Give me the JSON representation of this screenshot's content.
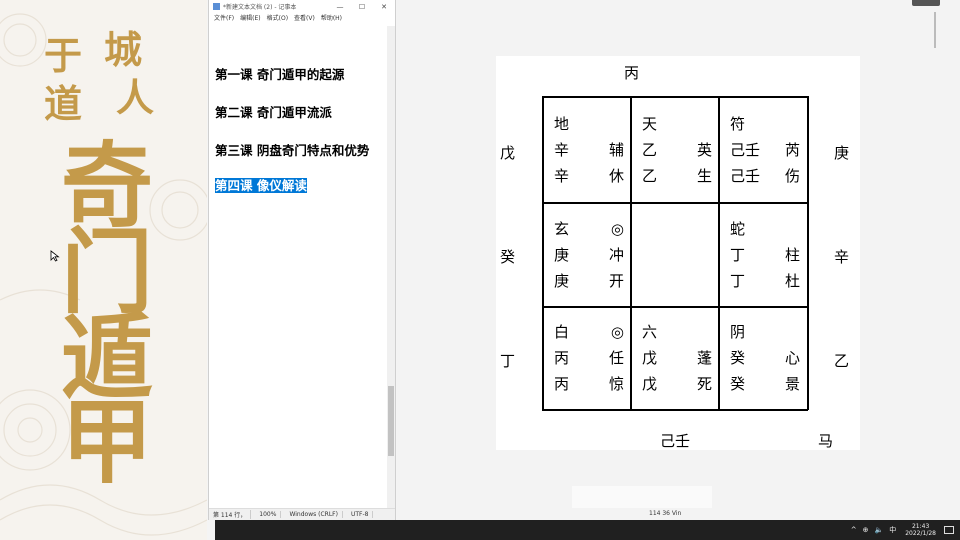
{
  "banner": {
    "author_chars": [
      "于",
      "城",
      "道",
      "人"
    ],
    "title_chars": [
      "奇",
      "门",
      "遁",
      "甲"
    ]
  },
  "notepad": {
    "window_title": "*新建文本文档 (2) - 记事本",
    "controls": [
      "—",
      "☐",
      "✕"
    ],
    "menu": [
      "文件(F)",
      "编辑(E)",
      "格式(O)",
      "查看(V)",
      "帮助(H)"
    ],
    "lessons": [
      "第一课 奇门遁甲的起源",
      "第二课 奇门遁甲流派",
      "第三课 阴盘奇门特点和优势",
      "第四课 像仪解读"
    ],
    "status": {
      "position": "第 114 行，",
      "zoom": "100%",
      "line_ending": "Windows (CRLF)",
      "encoding": "UTF-8"
    }
  },
  "chart": {
    "top_stem": "丙",
    "left_stems": [
      "戊",
      "癸",
      "丁"
    ],
    "right_stems": [
      "庚",
      "辛",
      "乙"
    ],
    "bottom_label": "己壬",
    "bottom_right": "马",
    "palaces": [
      {
        "rows": [
          [
            "地",
            ""
          ],
          [
            "辛",
            "辅"
          ],
          [
            "辛",
            "休"
          ]
        ]
      },
      {
        "rows": [
          [
            "天",
            ""
          ],
          [
            "乙",
            "英"
          ],
          [
            "乙",
            "生"
          ]
        ]
      },
      {
        "rows": [
          [
            "符",
            ""
          ],
          [
            "己壬",
            "芮"
          ],
          [
            "己壬",
            "伤"
          ]
        ]
      },
      {
        "rows": [
          [
            "玄",
            "◎"
          ],
          [
            "庚",
            "冲"
          ],
          [
            "庚",
            "开"
          ]
        ]
      },
      {
        "rows": [
          [
            "",
            ""
          ],
          [
            "",
            ""
          ],
          [
            "",
            ""
          ]
        ]
      },
      {
        "rows": [
          [
            "蛇",
            ""
          ],
          [
            "丁",
            "柱"
          ],
          [
            "丁",
            "杜"
          ]
        ]
      },
      {
        "rows": [
          [
            "白",
            "◎"
          ],
          [
            "丙",
            "任"
          ],
          [
            "丙",
            "惊"
          ]
        ]
      },
      {
        "rows": [
          [
            "六",
            ""
          ],
          [
            "戊",
            "蓬"
          ],
          [
            "戊",
            "死"
          ]
        ]
      },
      {
        "rows": [
          [
            "阴",
            ""
          ],
          [
            "癸",
            "心"
          ],
          [
            "癸",
            "景"
          ]
        ]
      }
    ]
  },
  "bottom_status": "114    36    Vin",
  "taskbar": {
    "tray_icons": [
      "^",
      "⊕",
      "🔈",
      "中"
    ],
    "time": "21:43",
    "date": "2022/1/28"
  },
  "colors": {
    "banner_gold": "#c49a4a",
    "selection_blue": "#0078d7",
    "taskbar": "#202020"
  }
}
